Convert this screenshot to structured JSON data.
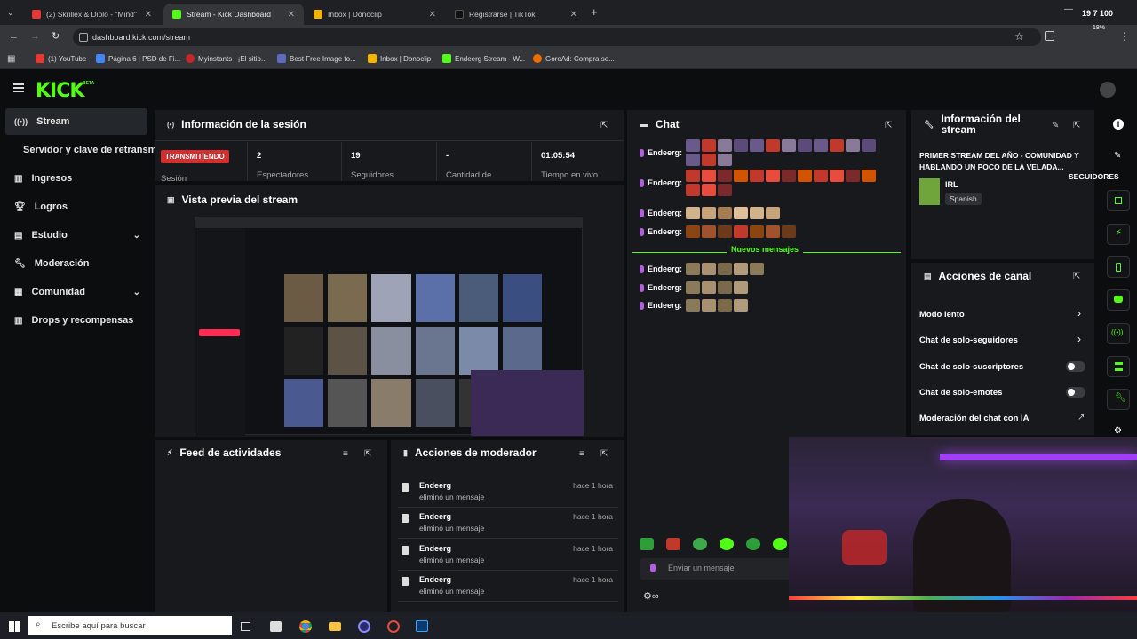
{
  "browser": {
    "tabs": [
      {
        "title": "(2) Skrillex & Diplo - \"Mind\" fe",
        "active": false,
        "color": "#e53935"
      },
      {
        "title": "Stream - Kick Dashboard",
        "active": true,
        "color": "#53fc18"
      },
      {
        "title": "Inbox | Donoclip",
        "active": false,
        "color": "#f4b400"
      },
      {
        "title": "Registrarse | TikTok",
        "active": false,
        "color": "#111111"
      }
    ],
    "url": "dashboard.kick.com/stream",
    "bookmarks": [
      "(1) YouTube",
      "Página 6 | PSD de Fi...",
      "Myinstants | ¡El sitio...",
      "Best Free Image to...",
      "Inbox | Donoclip",
      "Endeerg Stream - W...",
      "GoreAd: Compra se..."
    ],
    "overlay_time": "19 7 100",
    "overlay_pct": "18%"
  },
  "app": {
    "logo": "KICK",
    "logo_badge": "BETA",
    "accent": "#53fc18",
    "sidebar": [
      {
        "label": "Stream",
        "icon": "broadcast-icon",
        "active": true,
        "chevron": false
      },
      {
        "label": "Servidor y clave de retransm",
        "icon": "",
        "active": false,
        "chevron": false
      },
      {
        "label": "Ingresos",
        "icon": "chart-icon",
        "active": false,
        "chevron": false
      },
      {
        "label": "Logros",
        "icon": "trophy-icon",
        "active": false,
        "chevron": false
      },
      {
        "label": "Estudio",
        "icon": "studio-icon",
        "active": false,
        "chevron": true
      },
      {
        "label": "Moderación",
        "icon": "wrench-icon",
        "active": false,
        "chevron": false
      },
      {
        "label": "Comunidad",
        "icon": "community-icon",
        "active": false,
        "chevron": true
      },
      {
        "label": "Drops y recompensas",
        "icon": "gift-icon",
        "active": false,
        "chevron": false
      }
    ],
    "session": {
      "title": "Información de la sesión",
      "live_badge": "TRANSMITIENDO",
      "session_label": "Sesión",
      "stats": [
        {
          "value": "2",
          "label": "Espectadores"
        },
        {
          "value": "19",
          "label": "Seguidores"
        },
        {
          "value": "-",
          "label": "Cantidad de"
        },
        {
          "value": "01:05:54",
          "label": "Tiempo en vivo"
        }
      ]
    },
    "preview": {
      "title": "Vista previa del stream"
    },
    "activity": {
      "title": "Feed de actividades"
    },
    "mod_actions": {
      "title": "Acciones de moderador",
      "rows": [
        {
          "user": "Endeerg",
          "action": "eliminó un mensaje",
          "time": "hace 1 hora"
        },
        {
          "user": "Endeerg",
          "action": "eliminó un mensaje",
          "time": "hace 1 hora"
        },
        {
          "user": "Endeerg",
          "action": "eliminó un mensaje",
          "time": "hace 1 hora"
        },
        {
          "user": "Endeerg",
          "action": "eliminó un mensaje",
          "time": "hace 1 hora"
        }
      ]
    },
    "chat": {
      "title": "Chat",
      "messages": [
        {
          "user": "Endeerg:",
          "emotes": 15
        },
        {
          "user": "Endeerg:",
          "emotes": 15
        },
        {
          "user": "Endeerg:",
          "emotes": 6
        },
        {
          "user": "Endeerg:",
          "emotes": 7
        },
        {
          "user": "Endeerg:",
          "emotes": 5
        },
        {
          "user": "Endeerg:",
          "emotes": 4
        },
        {
          "user": "Endeerg:",
          "emotes": 4
        }
      ],
      "new_messages": "Nuevos mensajes",
      "input_placeholder": "Enviar un mensaje"
    },
    "stream_info": {
      "title": "Información del stream",
      "stream_title": "PRIMER STREAM DEL AÑO - COMUNIDAD Y HABLANDO UN POCO DE LA VELADA...",
      "category": "IRL",
      "language": "Spanish",
      "followers_label": "SEGUIDORES"
    },
    "channel_actions": {
      "title": "Acciones de canal",
      "options": [
        {
          "label": "Modo lento",
          "control": "arrow"
        },
        {
          "label": "Chat de solo-seguidores",
          "control": "arrow"
        },
        {
          "label": "Chat de solo-suscriptores",
          "control": "toggle"
        },
        {
          "label": "Chat de solo-emotes",
          "control": "toggle"
        },
        {
          "label": "Moderación del chat con IA",
          "control": "external"
        }
      ]
    }
  },
  "taskbar": {
    "search_placeholder": "Escribe aquí para buscar"
  }
}
